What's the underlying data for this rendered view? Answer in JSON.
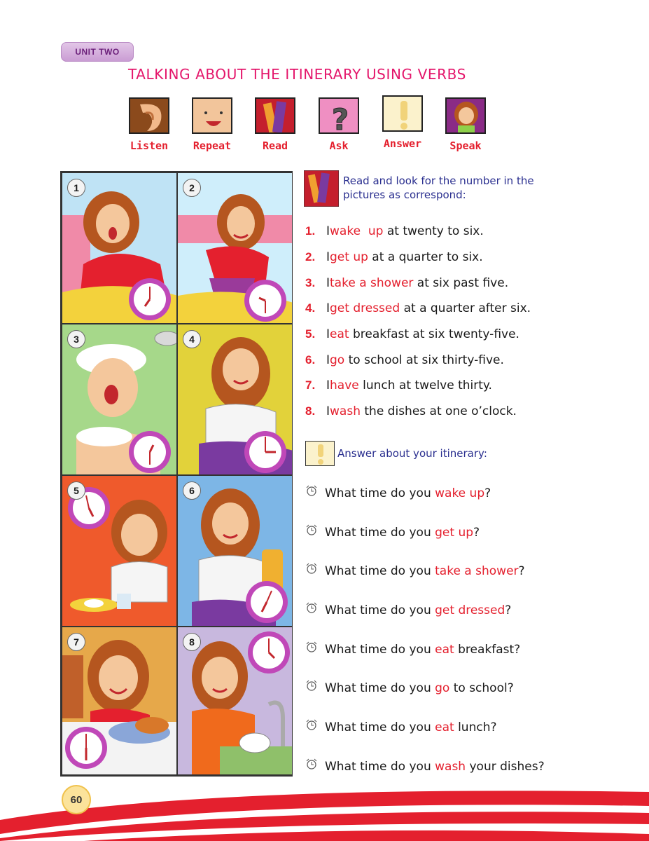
{
  "header": {
    "unit_label": "UNIT TWO",
    "title": "TALKING ABOUT THE ITINERARY USING VERBS"
  },
  "skills": [
    {
      "label": "Listen",
      "icon": "ear-icon"
    },
    {
      "label": "Repeat",
      "icon": "face-icon"
    },
    {
      "label": "Read",
      "icon": "books-icon"
    },
    {
      "label": "Ask",
      "icon": "question-icon"
    },
    {
      "label": "Answer",
      "icon": "exclamation-icon"
    },
    {
      "label": "Speak",
      "icon": "girl-speaking-icon"
    }
  ],
  "panels": [
    {
      "number": "1",
      "bg": "#bfe3f5"
    },
    {
      "number": "2",
      "bg": "#cfeefb"
    },
    {
      "number": "3",
      "bg": "#a6d88a"
    },
    {
      "number": "4",
      "bg": "#e2d23a"
    },
    {
      "number": "5",
      "bg": "#ef5a2c"
    },
    {
      "number": "6",
      "bg": "#7db6e6"
    },
    {
      "number": "7",
      "bg": "#e6a84a"
    },
    {
      "number": "8",
      "bg": "#c8b8de"
    }
  ],
  "instruction": "Read and look for the number in the pictures as correspond:",
  "sentences": [
    {
      "num": "1.",
      "pre": "I ",
      "verb": "wake  up",
      "post": " at twenty to six."
    },
    {
      "num": "2.",
      "pre": "I ",
      "verb": "get up",
      "post": " at a quarter to six."
    },
    {
      "num": "3.",
      "pre": "I ",
      "verb": "take a shower",
      "post": " at six past five."
    },
    {
      "num": "4.",
      "pre": "I ",
      "verb": "get dressed",
      "post": " at a quarter after six."
    },
    {
      "num": "5.",
      "pre": "I ",
      "verb": "eat",
      "post": " breakfast at six twenty-five."
    },
    {
      "num": "6.",
      "pre": "I ",
      "verb": "go",
      "post": " to school at six thirty-five."
    },
    {
      "num": "7.",
      "pre": "I ",
      "verb": "have",
      "post": " lunch at twelve thirty."
    },
    {
      "num": "8.",
      "pre": "I ",
      "verb": "wash",
      "post": " the dishes at one o’clock."
    }
  ],
  "answer_heading": "Answer about your itinerary:",
  "questions": [
    {
      "pre": "What time do you ",
      "verb": "wake up",
      "post": "?"
    },
    {
      "pre": "What time do you ",
      "verb": "get up",
      "post": "?"
    },
    {
      "pre": "What time do you ",
      "verb": "take a shower",
      "post": "?"
    },
    {
      "pre": "What time do you ",
      "verb": "get dressed",
      "post": "?"
    },
    {
      "pre": "What time do you ",
      "verb": "eat",
      "post": " breakfast?"
    },
    {
      "pre": "What time do you ",
      "verb": "go",
      "post": " to school?"
    },
    {
      "pre": "What time do you ",
      "verb": "eat",
      "post": " lunch?"
    },
    {
      "pre": "What time do you ",
      "verb": "wash",
      "post": " your dishes?"
    }
  ],
  "page_number": "60",
  "colors": {
    "accent_pink": "#e4166b",
    "accent_red": "#e4202e",
    "instruction_blue": "#2a2f8f"
  }
}
